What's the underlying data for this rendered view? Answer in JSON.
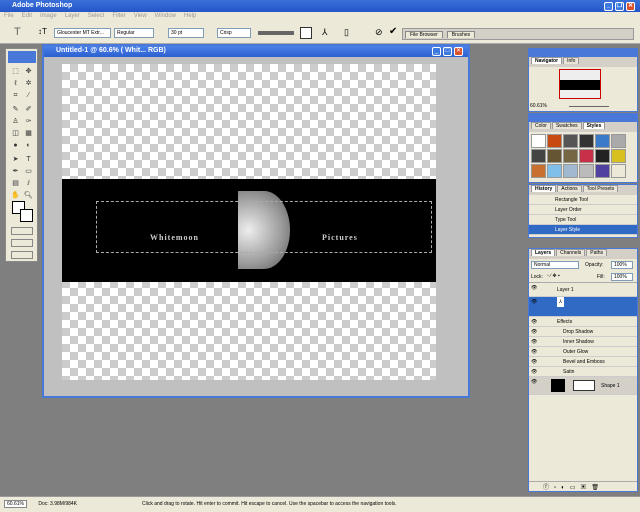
{
  "app": {
    "title": "Adobe Photoshop"
  },
  "menu": [
    "File",
    "Edit",
    "Image",
    "Layer",
    "Select",
    "Filter",
    "View",
    "Window",
    "Help"
  ],
  "options": {
    "font_family": "Gloucester MT Extr...",
    "font_style": "Regular",
    "font_size": "30 pt",
    "antialias": "Crisp",
    "tabs": [
      "File Browser",
      "Brushes"
    ]
  },
  "document": {
    "title": "Untitled-1 @ 60.6% (          Whit... RGB)",
    "left_text": "Whitemoon",
    "right_text": "Pictures"
  },
  "navigator": {
    "tabs": [
      "Navigator",
      "Info"
    ],
    "zoom": "60.61%"
  },
  "styles": {
    "tabs": [
      "Color",
      "Swatches",
      "Styles"
    ],
    "swatch_colors": [
      "#fff",
      "#c84a10",
      "#555",
      "#333",
      "#3a7ac8",
      "#aaa",
      "#444",
      "#665533",
      "#776644",
      "#c8304a",
      "#222",
      "#d8c020",
      "#c87030",
      "#80c0e8",
      "#a0b8d0",
      "#bbb",
      "#5040a0",
      "#ece9d8"
    ]
  },
  "history": {
    "tabs": [
      "History",
      "Actions",
      "Tool Presets"
    ],
    "items": [
      "Rectangle Tool",
      "Layer Order",
      "Type Tool",
      "Layer Style"
    ]
  },
  "layers": {
    "tabs": [
      "Layers",
      "Channels",
      "Paths"
    ],
    "blend": "Normal",
    "opacity_label": "Opacity:",
    "opacity": "100%",
    "lock_label": "Lock:",
    "fill_label": "Fill:",
    "fill": "100%",
    "items": [
      "Layer 1",
      "Effects",
      "Drop Shadow",
      "Inner Shadow",
      "Outer Glow",
      "Bevel and Emboss",
      "Satin",
      "Shape 1"
    ]
  },
  "status": {
    "zoom": "60.61%",
    "doc": "Doc: 3.98M/984K",
    "hint": "Click and drag to rotate. Hit enter to commit. Hit escape to cancel. Use the spacebar to access the navigation tools."
  }
}
